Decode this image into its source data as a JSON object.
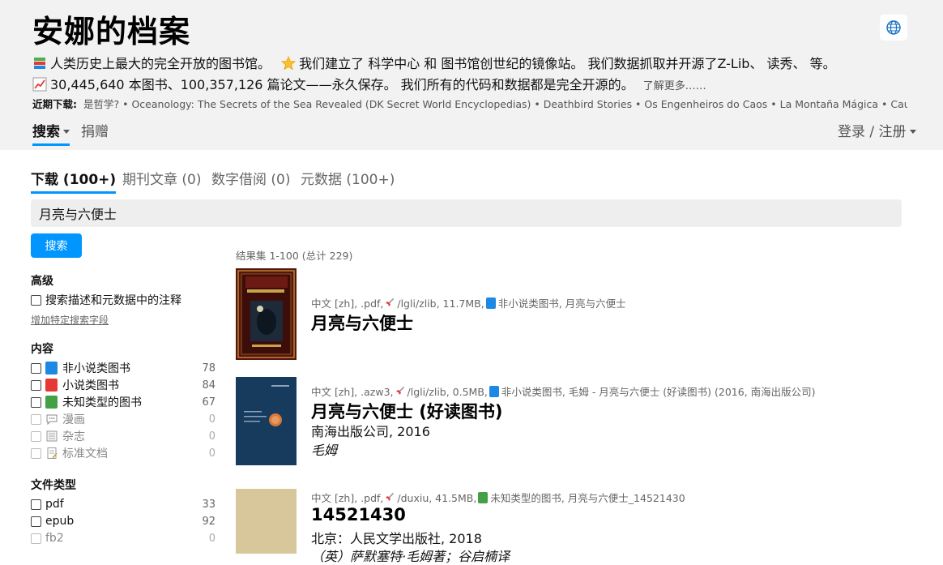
{
  "header": {
    "title": "安娜的档案",
    "tagline1_a": "人类历史上最大的完全开放的图书馆。",
    "tagline1_b": "我们建立了 科学中心 和 图书馆创世纪的镜像站。 我们数据抓取并开源了Z-Lib、 读秀、 等。",
    "tagline2_a": "30,445,640 本图书、100,357,126 篇论文——永久保存。 我们所有的代码和数据都是完全开源的。",
    "tagline2_more": "了解更多……",
    "recent_label": "近期下载:",
    "recent_items": "是哲学? • Oceanology: The Secrets of the Sea Revealed (DK Secret World Encyclopedias) • Deathbird Stories • Os Engenheiros do Caos • La Montaña Mágica • Causality",
    "nav_search": "搜索",
    "nav_donate": "捐赠",
    "login": "登录 / 注册"
  },
  "tabs": {
    "download": "下载 (100+)",
    "journal": "期刊文章 (0)",
    "lending": "数字借阅 (0)",
    "metadata": "元数据 (100+)"
  },
  "search": {
    "value": "月亮与六便士",
    "button": "搜索"
  },
  "sidebar": {
    "advanced_title": "高级",
    "advanced_option": "搜索描述和元数据中的注释",
    "add_field": "增加特定搜索字段",
    "content_title": "内容",
    "content": [
      {
        "label": "非小说类图书",
        "count": "78",
        "color": "#1e88e5"
      },
      {
        "label": "小说类图书",
        "count": "84",
        "color": "#e53935"
      },
      {
        "label": "未知类型的图书",
        "count": "67",
        "color": "#43a047"
      },
      {
        "label": "漫画",
        "count": "0",
        "icon": "speech-bubble-icon"
      },
      {
        "label": "杂志",
        "count": "0",
        "icon": "newspaper-icon"
      },
      {
        "label": "标准文档",
        "count": "0",
        "icon": "memo-icon"
      }
    ],
    "filetype_title": "文件类型",
    "filetypes": [
      {
        "label": "pdf",
        "count": "33"
      },
      {
        "label": "epub",
        "count": "92"
      },
      {
        "label": "fb2",
        "count": "0"
      }
    ]
  },
  "results": {
    "count": "结果集 1-100 (总计 229)",
    "items": [
      {
        "meta_a": "中文 [zh], .pdf,",
        "meta_b": "/lgli/zlib, 11.7MB,",
        "meta_c": "非小说类图书, 月亮与六便士",
        "title": "月亮与六便士"
      },
      {
        "meta_a": "中文 [zh], .azw3,",
        "meta_b": "/lgli/zlib, 0.5MB,",
        "meta_c": "非小说类图书, 毛姆 - 月亮与六便士 (好读图书) (2016, 南海出版公司)",
        "title": "月亮与六便士 (好读图书)",
        "publisher": "南海出版公司, 2016",
        "author": "毛姆"
      },
      {
        "meta_a": "中文 [zh], .pdf,",
        "meta_b": "/duxiu, 41.5MB,",
        "meta_c": "未知类型的图书, 月亮与六便士_14521430",
        "title": "14521430",
        "publisher": "北京：人民文学出版社, 2018",
        "author": "（英）萨默塞特·毛姆著；谷启楠译"
      }
    ]
  },
  "colors": {
    "accent": "#0095ff",
    "header_bg": "#f2f2f2"
  }
}
